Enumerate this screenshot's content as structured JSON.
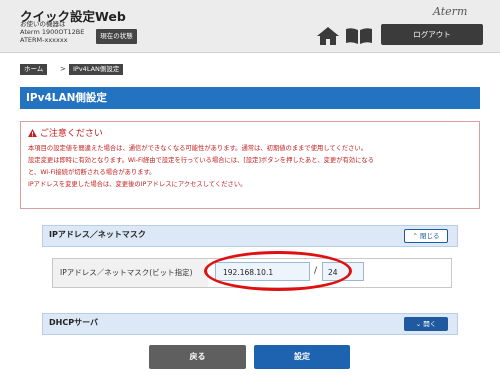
{
  "header": {
    "app_title": "クイック設定Web",
    "device_lines": [
      "お使いの機器は",
      "Aterm 1900OT12BE",
      "ATERM-xxxxxx"
    ],
    "status_button": "現在の状態",
    "brand": "Aterm",
    "logout_button": "ログアウト",
    "icons": [
      "home-icon",
      "manual-book-icon"
    ]
  },
  "breadcrumb": {
    "items": [
      "ホーム",
      "IPv4LAN側設定"
    ],
    "separator": ">"
  },
  "page_title": "IPv4LAN側設定",
  "caution": {
    "heading": "ご注意ください",
    "lines": [
      "本項目の設定値を間違えた場合は、通信ができなくなる可能性があります。通常は、初期値のままで使用してください。",
      "設定変更は即時に有効となります。Wi-Fi経由で設定を行っている場合には、[設定]ボタンを押したあと、変更が有効になる",
      "と、Wi-Fi接続が切断される場合があります。",
      "IPアドレスを変更した場合は、変更後のIPアドレスにアクセスしてください。"
    ]
  },
  "ip_section": {
    "title": "IPアドレス／ネットマスク",
    "toggle_label": "閉じる",
    "field_label": "IPアドレス／ネットマスク(ビット指定)",
    "ip_value": "192.168.10.1",
    "slash": "/",
    "mask_value": "24"
  },
  "dhcp_section": {
    "title": "DHCPサーバ",
    "toggle_label": "開く"
  },
  "buttons": {
    "back": "戻る",
    "set": "設定"
  },
  "colors": {
    "accent_blue": "#2473c1",
    "warning_red": "#c21f1f",
    "highlight_red": "#e01010"
  }
}
